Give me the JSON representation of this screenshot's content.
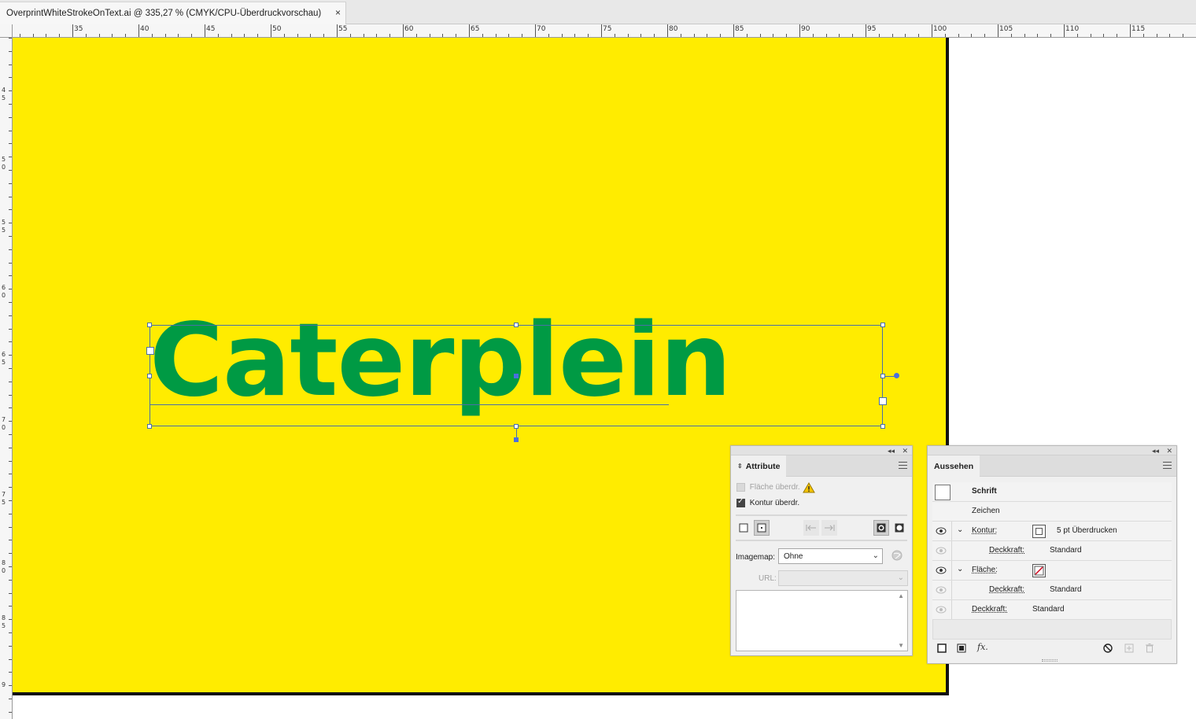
{
  "document_tab": {
    "title": "OverprintWhiteStrokeOnText.ai @ 335,27 % (CMYK/CPU-Überdruckvorschau)",
    "close": "×"
  },
  "ruler": {
    "horizontal_labels": [
      "35",
      "40",
      "45",
      "50",
      "55",
      "60",
      "65",
      "70",
      "75",
      "80",
      "85",
      "90",
      "95",
      "100",
      "105",
      "110",
      "115"
    ],
    "vertical_labels": [
      "4",
      "5",
      "5",
      "0",
      "5",
      "5",
      "6",
      "0",
      "6",
      "5",
      "7",
      "0",
      "7",
      "5",
      "8",
      "0",
      "8",
      "5",
      "9"
    ]
  },
  "artboard": {
    "background_color": "#ffec00",
    "text": "Caterplein",
    "text_color": "#009a44"
  },
  "attribute_panel": {
    "tab_label": "Attribute",
    "fill_overprint_label": "Fläche überdr.",
    "stroke_overprint_label": "Kontur überdr.",
    "fill_overprint_checked": false,
    "stroke_overprint_checked": true,
    "imagemap_label": "Imagemap:",
    "imagemap_value": "Ohne",
    "url_label": "URL:",
    "url_value": ""
  },
  "appearance_panel": {
    "tab_label": "Aussehen",
    "object_name": "Schrift",
    "character_row": "Zeichen",
    "stroke_label": "Kontur:",
    "stroke_value": "5 pt Überdrucken",
    "stroke_opacity_label": "Deckkraft:",
    "stroke_opacity_value": "Standard",
    "fill_label": "Fläche:",
    "fill_opacity_label": "Deckkraft:",
    "fill_opacity_value": "Standard",
    "object_opacity_label": "Deckkraft:",
    "object_opacity_value": "Standard",
    "fx_label": "fx."
  }
}
